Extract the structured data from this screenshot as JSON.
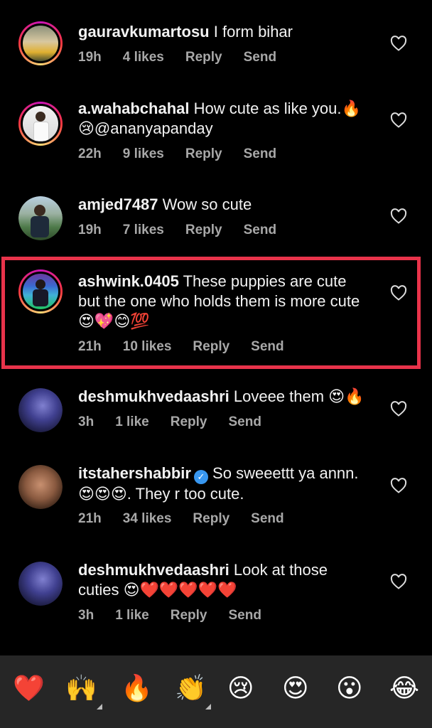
{
  "comments": [
    {
      "user": "gauravkumartosu",
      "text": " I form bihar",
      "time": "19h",
      "likes": "4 likes",
      "reply": "Reply",
      "send": "Send"
    },
    {
      "user": "a.wahabchahal",
      "text": " How cute as like you.🔥😢@ananyapanday",
      "time": "22h",
      "likes": "9 likes",
      "reply": "Reply",
      "send": "Send"
    },
    {
      "user": "amjed7487",
      "text": " Wow so cute",
      "time": "19h",
      "likes": "7 likes",
      "reply": "Reply",
      "send": "Send"
    },
    {
      "user": "ashwink.0405",
      "text": " These puppies are cute but the one who holds them is more cute 😍💖😊💯",
      "time": "21h",
      "likes": "10 likes",
      "reply": "Reply",
      "send": "Send"
    },
    {
      "user": "deshmukhvedaashri",
      "text": " Loveee them 😍🔥",
      "time": "3h",
      "likes": "1 like",
      "reply": "Reply",
      "send": "Send"
    },
    {
      "user": "itstahershabbir",
      "text": " So sweeettt ya annn. 😍😍😍. They r too cute.",
      "time": "21h",
      "likes": "34 likes",
      "reply": "Reply",
      "send": "Send"
    },
    {
      "user": "deshmukhvedaashri",
      "text": " Look at those cuties 😍❤️❤️❤️❤️❤️",
      "time": "3h",
      "likes": "1 like",
      "reply": "Reply",
      "send": "Send"
    }
  ],
  "verified_mark": "✓",
  "reactions": [
    "❤️",
    "🙌",
    "🔥",
    "👏",
    "😢",
    "😍",
    "😮",
    "😂"
  ],
  "colors": {
    "highlight": "#e8334a",
    "meta": "#a8a8a8",
    "bar": "#262626"
  }
}
